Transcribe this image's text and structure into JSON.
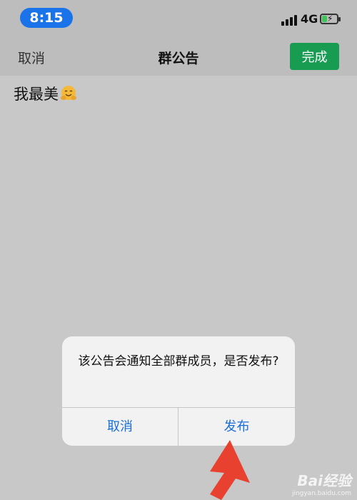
{
  "status": {
    "time": "8:15",
    "network": "4G",
    "icons": [
      "signal-icon",
      "battery-charging-icon"
    ],
    "accent": "#1a73e8"
  },
  "nav": {
    "cancel_label": "取消",
    "title": "群公告",
    "done_label": "完成",
    "done_color": "#179c52"
  },
  "content": {
    "text": "我最美",
    "emoji_icon": "hugging-face-icon"
  },
  "dialog": {
    "message": "该公告会通知全部群成员，是否发布?",
    "cancel_label": "取消",
    "publish_label": "发布",
    "button_color": "#1a6ed8"
  },
  "watermark": {
    "logo": "Bai经验",
    "sub": "jingyan.baidu.com"
  }
}
